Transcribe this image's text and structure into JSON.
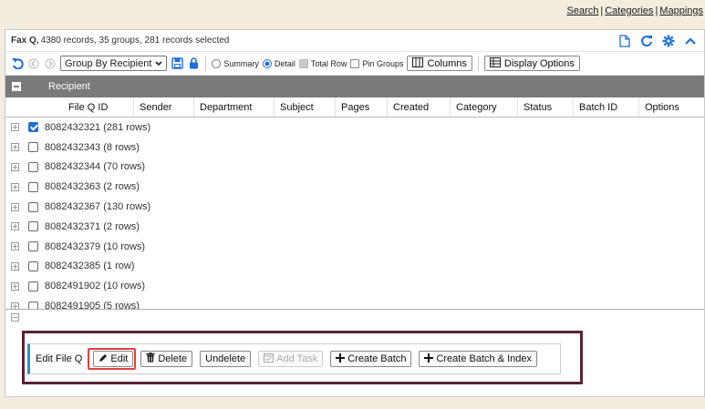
{
  "top_links": {
    "search": "Search",
    "categories": "Categories",
    "mappings": "Mappings",
    "separator": "|"
  },
  "title": {
    "name": "Fax Q,",
    "summary": "4380 records, 35 groups, 281 records selected"
  },
  "toolbar": {
    "group_by": "Group By Recipient",
    "summary_label": "Summary",
    "detail_label": "Detail",
    "total_row_label": "Total Row",
    "pin_groups_label": "Pin Groups",
    "columns_label": "Columns",
    "display_options_label": "Display Options",
    "view_mode": "Detail"
  },
  "group_header": "Recipient",
  "columns": [
    "File Q ID",
    "Sender",
    "Department",
    "Subject",
    "Pages",
    "Created",
    "Category",
    "Status",
    "Batch ID",
    "Options"
  ],
  "rows": [
    {
      "label": "8082432321 (281 rows)",
      "checked": true
    },
    {
      "label": "8082432343 (8 rows)",
      "checked": false
    },
    {
      "label": "8082432344 (70 rows)",
      "checked": false
    },
    {
      "label": "8082432363 (2 rows)",
      "checked": false
    },
    {
      "label": "8082432367 (130 rows)",
      "checked": false
    },
    {
      "label": "8082432371 (2 rows)",
      "checked": false
    },
    {
      "label": "8082432379 (10 rows)",
      "checked": false
    },
    {
      "label": "8082432385 (1 row)",
      "checked": false
    },
    {
      "label": "8082491902 (10 rows)",
      "checked": false
    },
    {
      "label": "8082491905 (5 rows)",
      "checked": false
    }
  ],
  "actions": {
    "label": "Edit File Q",
    "edit": "Edit",
    "delete": "Delete",
    "undelete": "Undelete",
    "add_task": "Add Task",
    "create_batch": "Create Batch",
    "create_batch_index": "Create Batch & Index"
  },
  "colors": {
    "accent": "#1e6fd9",
    "header_gray": "#7a7a7a",
    "highlight_red": "#e24040",
    "highlight_outer": "#5a2238",
    "page_bg": "#f3ecdf"
  }
}
